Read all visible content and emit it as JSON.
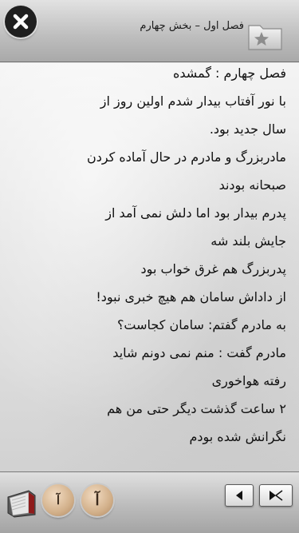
{
  "header": {
    "chapter_title": "فصل اول – بخش چهارم"
  },
  "content": {
    "lines": [
      "فصل چهارم : گمشده",
      "با نور آفتاب بیدار شدم اولین روز از",
      "سال جدید بود.",
      "مادربزرگ و مادرم در حال آماده کردن",
      "صبحانه بودند",
      "پدرم بیدار بود اما دلش نمی آمد از",
      "جایش بلند شه",
      "پدربزرگ هم غرق خواب بود",
      "از داداش سامان هم هیچ خبری نبود!",
      "به مادرم گفتم: سامان کجاست؟",
      "مادرم گفت : منم نمی دونم شاید",
      "رفته هواخوری",
      "۲ ساعت گذشت دیگر حتی من هم",
      "نگرانش شده بودم"
    ]
  },
  "toolbar": {
    "font_small_label": "آ",
    "font_large_label": "آ"
  },
  "icons": {
    "close": "close-icon",
    "bookmark": "bookmark-star-icon",
    "book": "book-icon",
    "prev": "arrow-left-icon",
    "next": "arrow-right-icon"
  }
}
